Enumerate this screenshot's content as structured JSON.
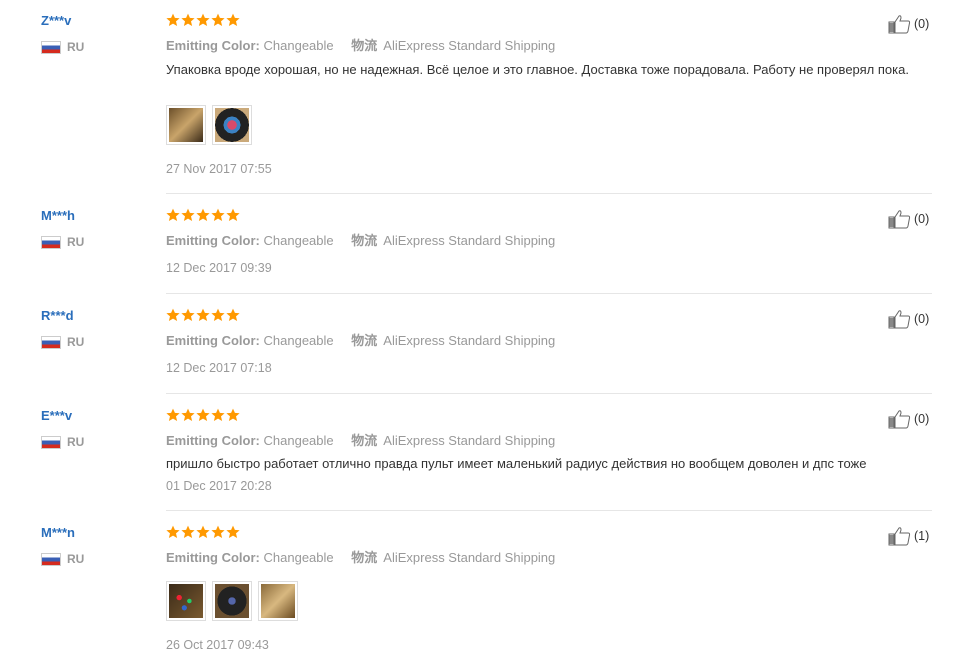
{
  "colors": {
    "star": "#ff9900",
    "username": "#2a6ebb",
    "muted": "#999999"
  },
  "reviews": [
    {
      "user": "Z***v",
      "country": "RU",
      "stars": 5,
      "color_label": "Emitting Color:",
      "color_value": "Changeable",
      "shipping_label": "物流",
      "shipping_value": "AliExpress Standard Shipping",
      "text": "Упаковка вроде хорошая, но не надежная. Всё целое и это главное. Доставка тоже порадовала. Работу не проверял пока.",
      "photos": [
        "package-photo",
        "device-photo"
      ],
      "date": "27 Nov 2017 07:55",
      "likes": "(0)"
    },
    {
      "user": "M***h",
      "country": "RU",
      "stars": 5,
      "color_label": "Emitting Color:",
      "color_value": "Changeable",
      "shipping_label": "物流",
      "shipping_value": "AliExpress Standard Shipping",
      "text": "",
      "photos": [],
      "date": "12 Dec 2017 09:39",
      "likes": "(0)"
    },
    {
      "user": "R***d",
      "country": "RU",
      "stars": 5,
      "color_label": "Emitting Color:",
      "color_value": "Changeable",
      "shipping_label": "物流",
      "shipping_value": "AliExpress Standard Shipping",
      "text": "",
      "photos": [],
      "date": "12 Dec 2017 07:18",
      "likes": "(0)"
    },
    {
      "user": "E***v",
      "country": "RU",
      "stars": 5,
      "color_label": "Emitting Color:",
      "color_value": "Changeable",
      "shipping_label": "物流",
      "shipping_value": "AliExpress Standard Shipping",
      "text": "пришло быстро работает отлично правда пульт имеет маленький радиус действия но вообщем доволен и дпс тоже",
      "photos": [],
      "date": "01 Dec 2017 20:28",
      "likes": "(0)"
    },
    {
      "user": "M***n",
      "country": "RU",
      "stars": 5,
      "color_label": "Emitting Color:",
      "color_value": "Changeable",
      "shipping_label": "物流",
      "shipping_value": "AliExpress Standard Shipping",
      "text": "",
      "photos": [
        "remote-photo",
        "device-photo",
        "package-photo"
      ],
      "date": "26 Oct 2017 09:43",
      "likes": "(1)"
    }
  ]
}
